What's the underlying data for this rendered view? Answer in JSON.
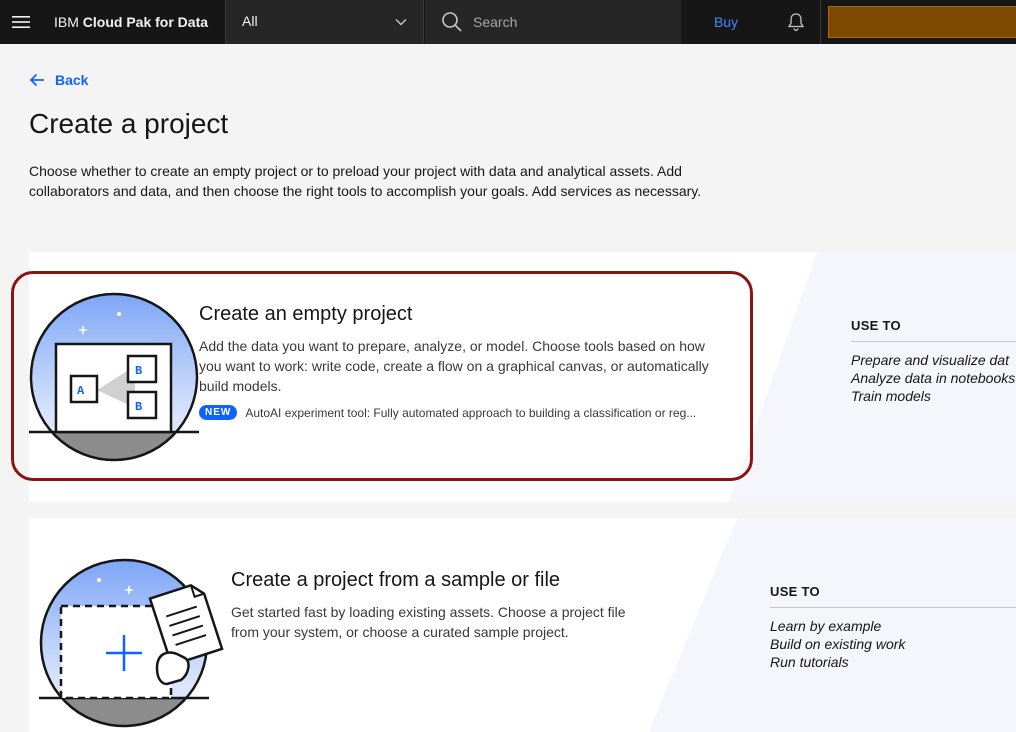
{
  "header": {
    "menu_icon": "hamburger-menu-icon",
    "brand_prefix": "IBM",
    "brand_name": "Cloud Pak for Data",
    "scope_selected": "All",
    "search_placeholder": "Search",
    "buy_label": "Buy",
    "notification_icon": "bell-icon",
    "account_color": "#7b4a00"
  },
  "page": {
    "back_label": "Back",
    "title": "Create a project",
    "description": "Choose whether to create an empty project or to preload your project with data and analytical assets. Add collaborators and data, and then choose the right tools to accomplish your goals. Add services as necessary."
  },
  "cards": [
    {
      "title": "Create an empty project",
      "description": "Add the data you want to prepare, analyze, or model. Choose tools based on how you want to work: write code, create a flow on a graphical canvas, or automatically build models.",
      "new_tag": "NEW",
      "new_text": "AutoAI experiment tool: Fully automated approach to building a classification or reg...",
      "use_to_title": "USE TO",
      "use_to_items": [
        "Prepare and visualize dat",
        "Analyze data in notebooks",
        "Train models"
      ],
      "highlighted": true
    },
    {
      "title": "Create a project from a sample or file",
      "description": "Get started fast by loading existing assets. Choose a project file from your system, or choose a curated sample project.",
      "use_to_title": "USE TO",
      "use_to_items": [
        "Learn by example",
        "Build on existing work",
        "Run tutorials"
      ]
    }
  ],
  "colors": {
    "header_bg": "#161616",
    "link_blue": "#0f62fe",
    "highlight_border": "#8a1414",
    "new_tag_bg": "#0f62fe"
  }
}
